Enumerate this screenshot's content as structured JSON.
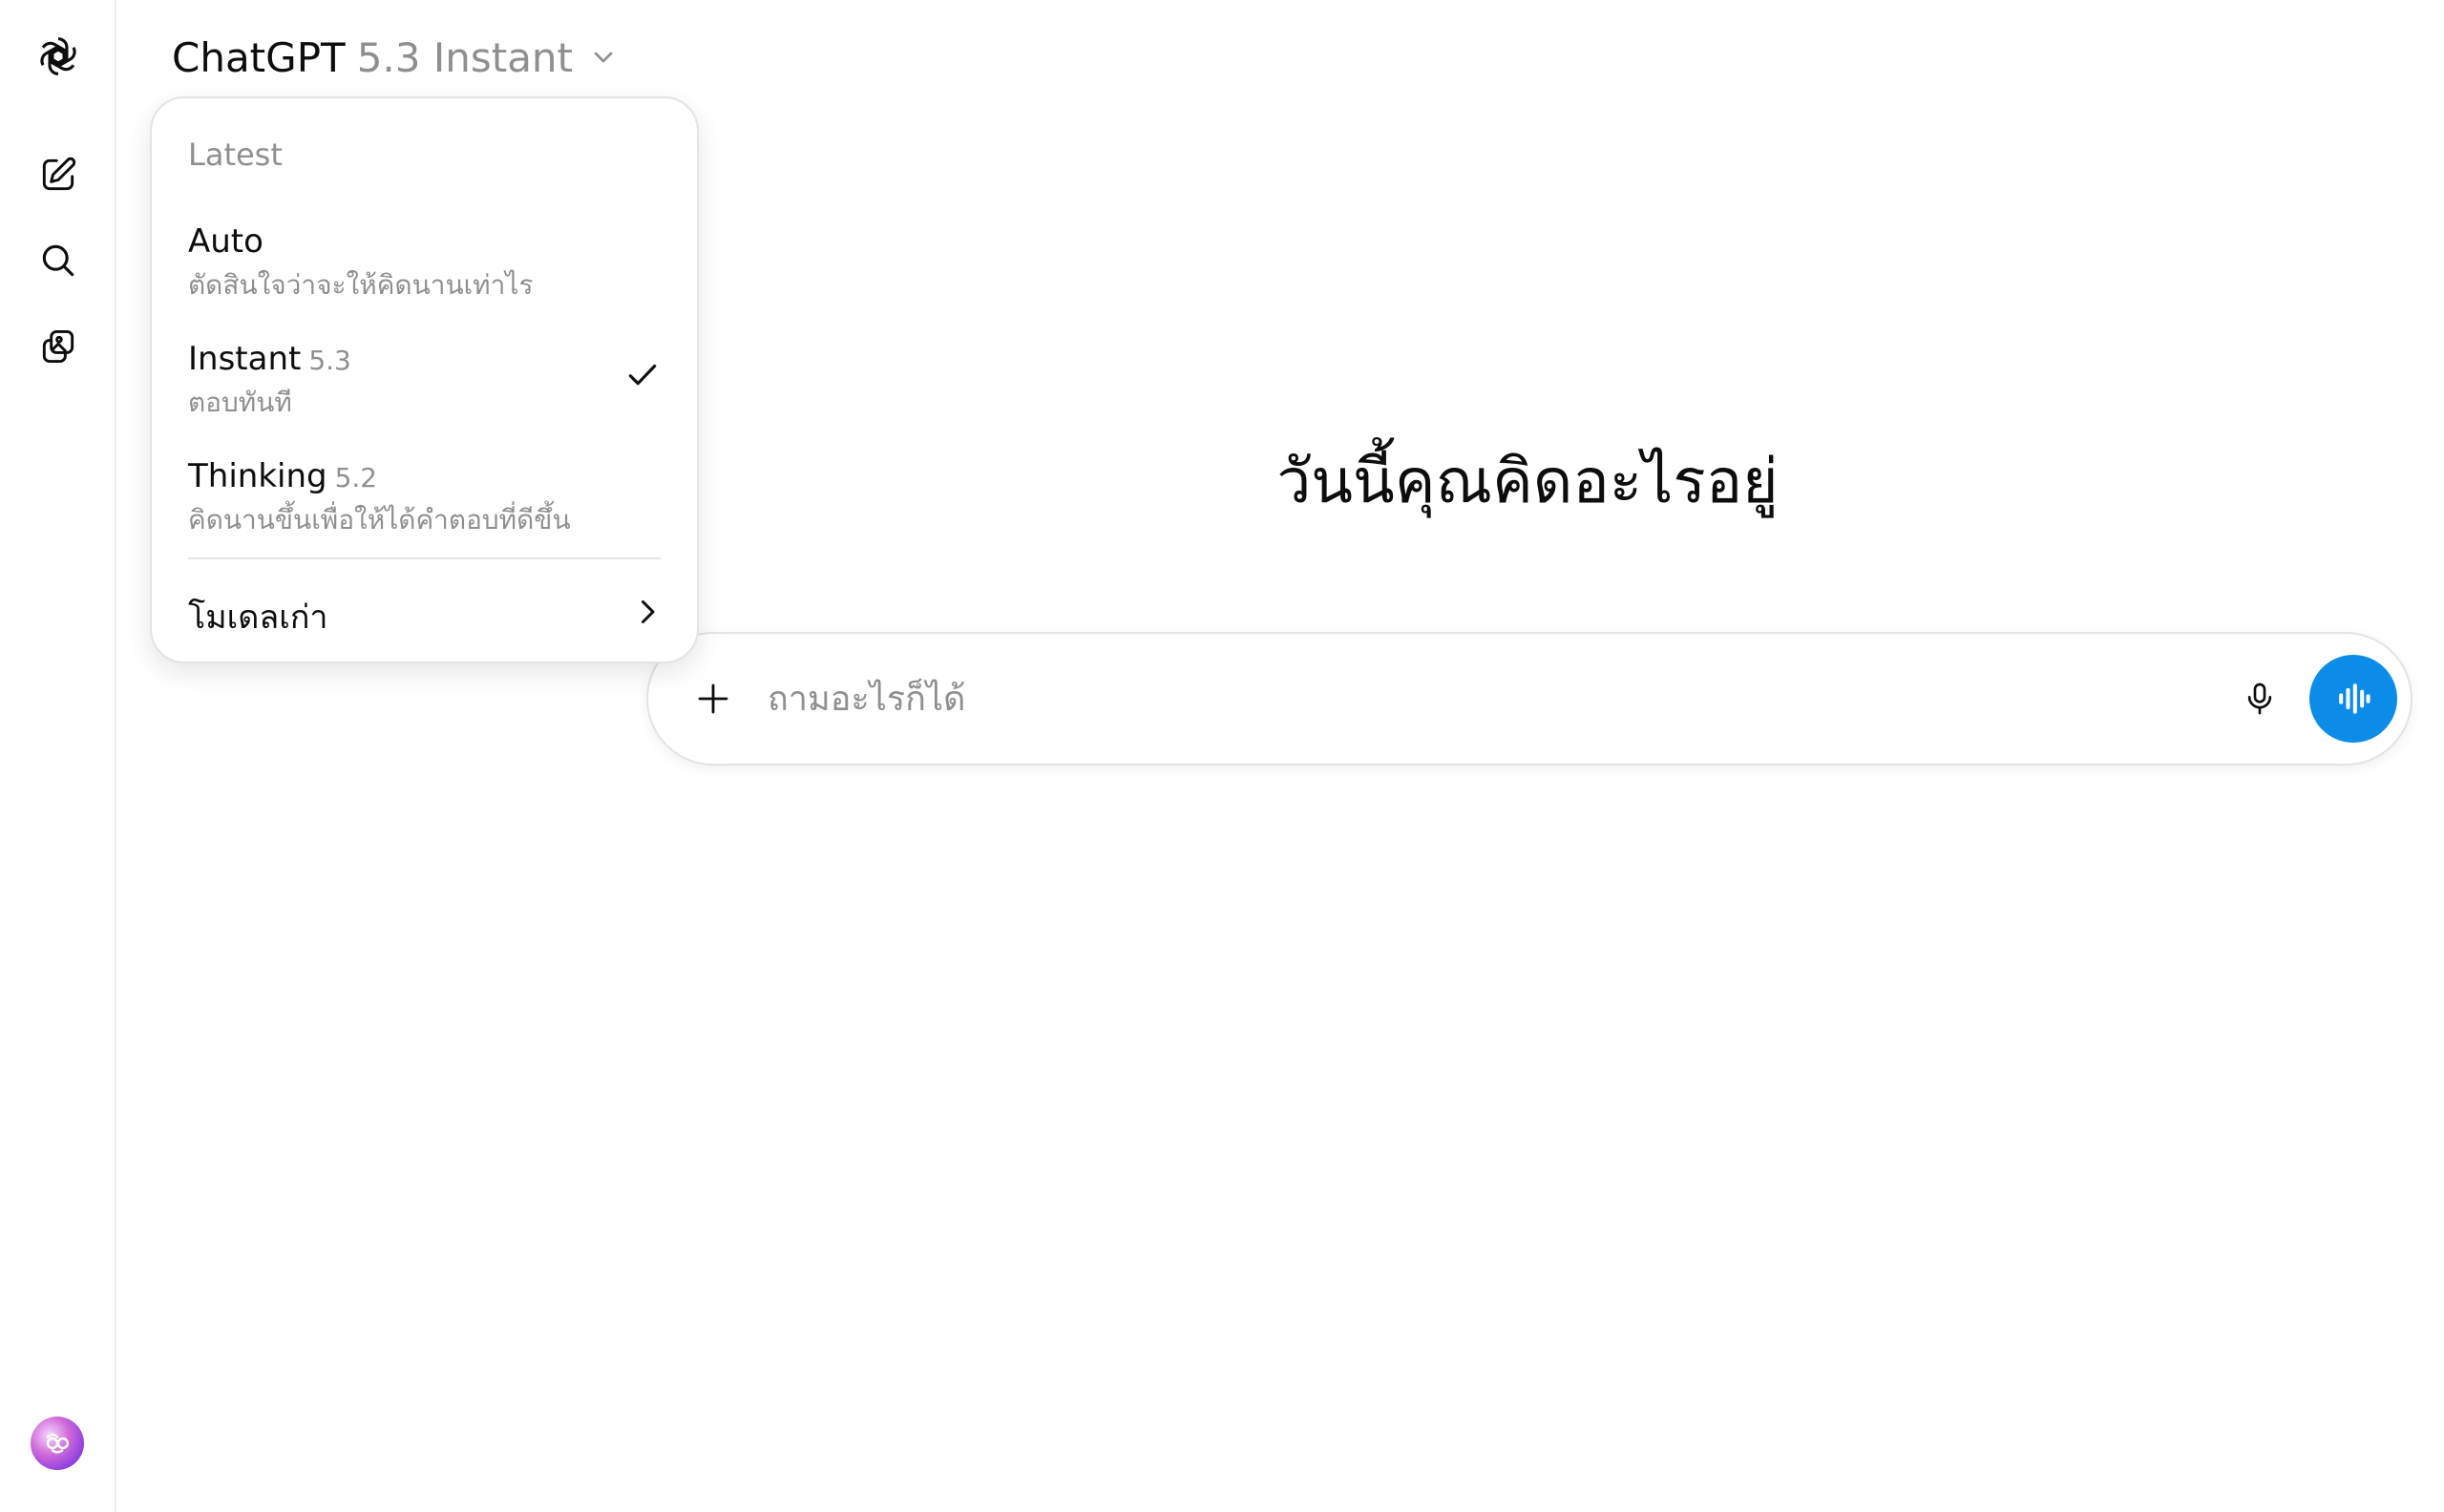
{
  "header": {
    "brand": "ChatGPT",
    "model_variant": "5.3 Instant"
  },
  "sidebar": {
    "items": [
      {
        "icon": "openai-logo-icon"
      },
      {
        "icon": "new-chat-icon"
      },
      {
        "icon": "search-icon"
      },
      {
        "icon": "images-icon"
      }
    ],
    "avatar_icon": "user-avatar"
  },
  "model_menu": {
    "section_label": "Latest",
    "items": [
      {
        "title": "Auto",
        "version": "",
        "description": "ตัดสินใจว่าจะให้คิดนานเท่าไร",
        "selected": false
      },
      {
        "title": "Instant",
        "version": "5.3",
        "description": "ตอบทันที",
        "selected": true
      },
      {
        "title": "Thinking",
        "version": "5.2",
        "description": "คิดนานขึ้นเพื่อให้ได้คำตอบที่ดีขึ้น",
        "selected": false
      }
    ],
    "legacy_label": "โมเดลเก่า"
  },
  "main": {
    "heading": "วันนี้คุณคิดอะไรอยู่"
  },
  "composer": {
    "placeholder": "ถามอะไรก็ได้",
    "value": "",
    "accent_color": "#0c8ce9"
  }
}
